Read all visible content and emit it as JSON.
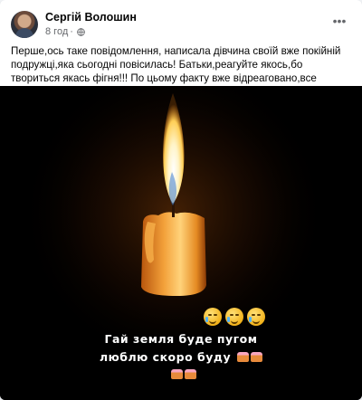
{
  "post": {
    "author": "Сергій Волошин",
    "time": "8 год",
    "separator": "·",
    "menu_icon": "more-dots-icon",
    "text": "Перше,ось таке повідомлення, написала дівчина своїй вже покійній подружці,яка сьогодні повісилась! Батьки,реагуйте якось,бо твориться якась фігня!!! По цьому факту вже відреаговано,все добре!",
    "image": {
      "caption_line1": "Гай земля буде пугом",
      "caption_line2": "люблю скоро буду",
      "emoji": [
        "crying-face-icon",
        "crying-face-icon",
        "crying-face-icon"
      ],
      "decorations": [
        "cake-icon",
        "cake-icon"
      ]
    },
    "accent_color": "#050505",
    "meta_color": "#65676b"
  }
}
